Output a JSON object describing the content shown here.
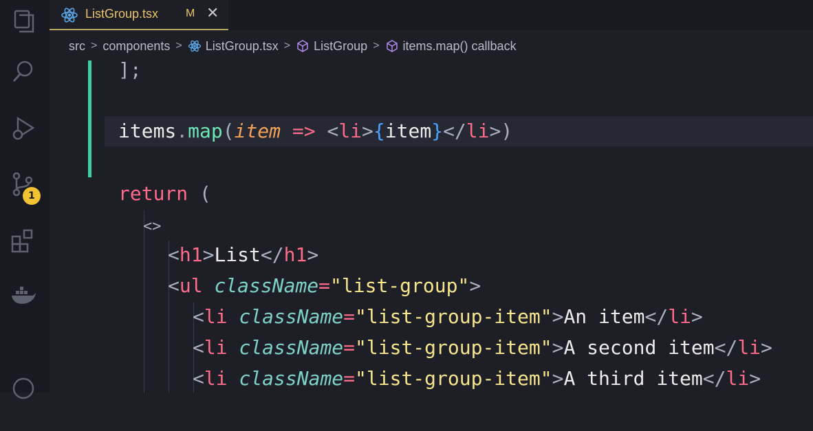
{
  "tab": {
    "filename": "ListGroup.tsx",
    "modified_marker": "M",
    "close_glyph": "✕",
    "icon": "react-icon"
  },
  "activity_bar": {
    "icons": [
      "explorer-icon",
      "search-icon",
      "run-debug-icon",
      "source-control-icon",
      "extensions-icon",
      "docker-icon"
    ],
    "source_control_badge": "1",
    "badge_color": "#f1c232"
  },
  "breadcrumb": {
    "items": [
      "src",
      "components",
      "ListGroup.tsx",
      "ListGroup",
      "items.map() callback"
    ],
    "separator": ">"
  },
  "code": {
    "line1": {
      "text": "];"
    },
    "line2": {
      "obj": "items",
      "dot": ".",
      "method": "map",
      "open": "(",
      "param": "item",
      "arrow": "=>",
      "lt1": "<",
      "tag1": "li",
      "gt1": ">",
      "brace_open": "{",
      "expr": "item",
      "brace_close": "}",
      "lt2": "</",
      "tag2": "li",
      "gt2": ">",
      "close": ")"
    },
    "line3": {
      "keyword": "return",
      "paren": "("
    },
    "line4": {
      "fragment": "<>"
    },
    "line5": {
      "lt": "<",
      "tag": "h1",
      "gt": ">",
      "content": "List",
      "close_lt": "</",
      "close_tag": "h1",
      "close_gt": ">"
    },
    "line6": {
      "lt": "<",
      "tag": "ul",
      "attr": "className",
      "eq": "=",
      "value": "\"list-group\"",
      "gt": ">"
    },
    "items": [
      {
        "lt": "<",
        "tag": "li",
        "attr": "className",
        "eq": "=",
        "value": "\"list-group-item\"",
        "gt": ">",
        "content": "An item",
        "close_lt": "</",
        "close_tag": "li",
        "close_gt": ">"
      },
      {
        "lt": "<",
        "tag": "li",
        "attr": "className",
        "eq": "=",
        "value": "\"list-group-item\"",
        "gt": ">",
        "content": "A second item",
        "close_lt": "</",
        "close_tag": "li",
        "close_gt": ">"
      },
      {
        "lt": "<",
        "tag": "li",
        "attr": "className",
        "eq": "=",
        "value": "\"list-group-item\"",
        "gt": ">",
        "content": "A third item",
        "close_lt": "</",
        "close_tag": "li",
        "close_gt": ">"
      }
    ]
  },
  "colors": {
    "accent_green": "#3fd0a8",
    "tab_text": "#e9c46a"
  }
}
